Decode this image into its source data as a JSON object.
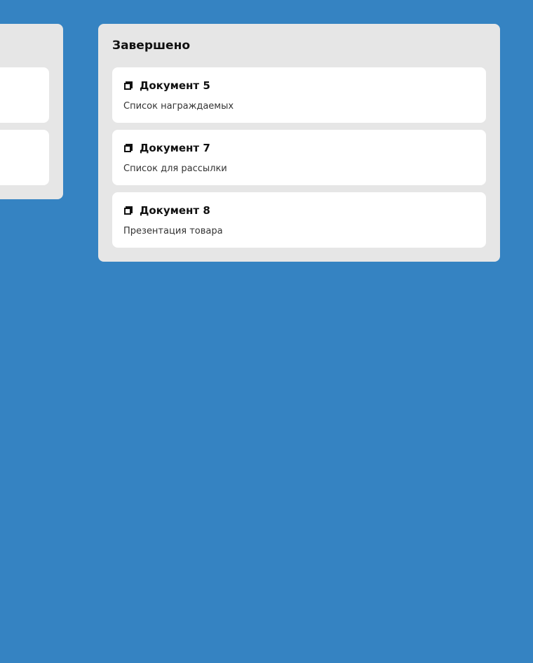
{
  "columns": [
    {
      "title": "Завершено",
      "cards": [
        {
          "icon": "document-icon",
          "title": "Документ 5",
          "description": "Список награждаемых"
        },
        {
          "icon": "document-icon",
          "title": "Документ 7",
          "description": "Список для рассылки"
        },
        {
          "icon": "document-icon",
          "title": "Документ 8",
          "description": "Презентация товара"
        }
      ]
    }
  ]
}
